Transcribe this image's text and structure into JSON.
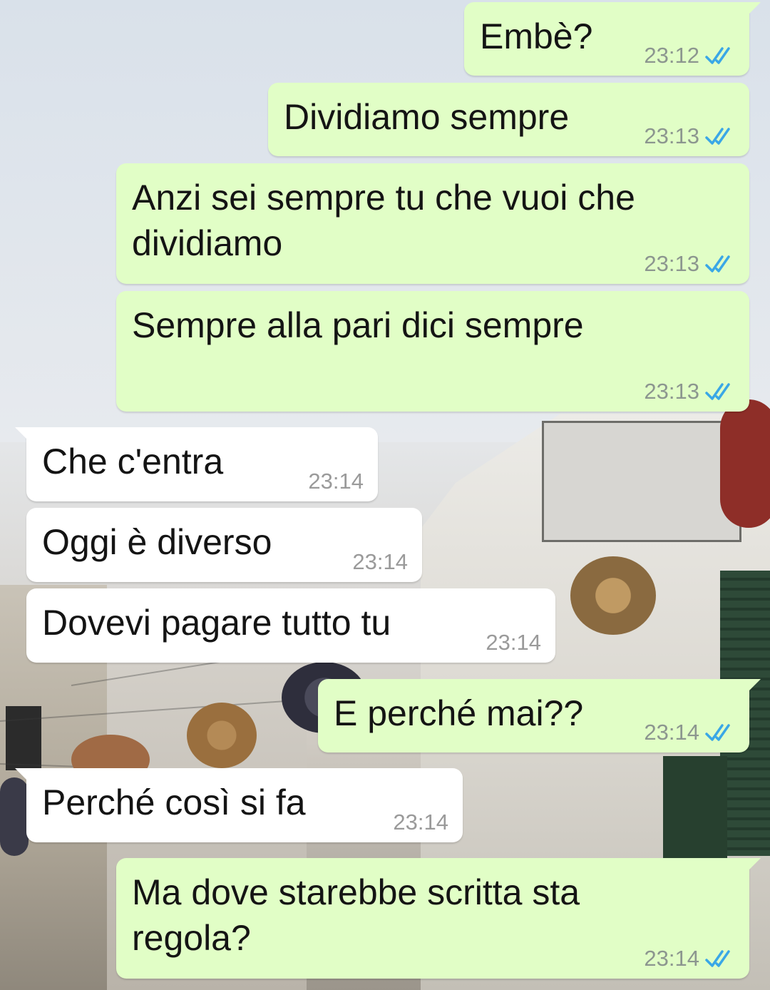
{
  "colors": {
    "outgoing_bubble": "#e1fec6",
    "incoming_bubble": "#ffffff",
    "read_ticks": "#3aa7e6",
    "timestamp": "#8c968f"
  },
  "messages": [
    {
      "direction": "out",
      "text": "Embè?",
      "time": "23:12",
      "status": "read",
      "tail": true
    },
    {
      "direction": "out",
      "text": "Dividiamo sempre",
      "time": "23:13",
      "status": "read",
      "tail": false
    },
    {
      "direction": "out",
      "text": "Anzi sei sempre tu che vuoi che dividiamo",
      "time": "23:13",
      "status": "read",
      "tail": false
    },
    {
      "direction": "out",
      "text": "Sempre alla pari dici sempre",
      "time": "23:13",
      "status": "read",
      "tail": false
    },
    {
      "direction": "in",
      "text": "Che c'entra",
      "time": "23:14",
      "tail": true
    },
    {
      "direction": "in",
      "text": "Oggi è diverso",
      "time": "23:14",
      "tail": false
    },
    {
      "direction": "in",
      "text": "Dovevi pagare tutto tu",
      "time": "23:14",
      "tail": false
    },
    {
      "direction": "out",
      "text": "E perché mai??",
      "time": "23:14",
      "status": "read",
      "tail": true
    },
    {
      "direction": "in",
      "text": "Perché così si fa",
      "time": "23:14",
      "tail": true
    },
    {
      "direction": "out",
      "text": "Ma dove starebbe scritta sta regola?",
      "time": "23:14",
      "status": "read",
      "tail": true
    }
  ]
}
